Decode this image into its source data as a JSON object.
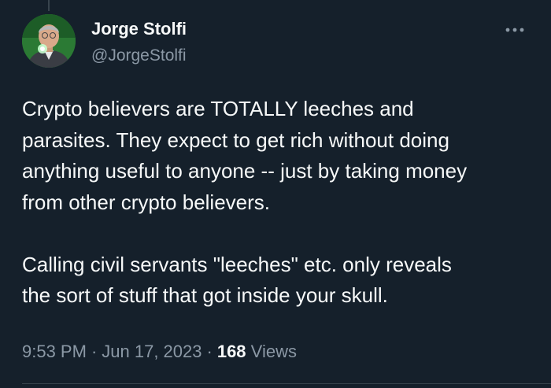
{
  "tweet": {
    "author": {
      "name": "Jorge Stolfi",
      "handle": "@JorgeStolfi"
    },
    "more_icon": "more-horizontal-icon",
    "text": "Crypto believers are TOTALLY leeches and\nparasites.  They expect to get rich without doing\nanything useful to anyone -- just by taking money\nfrom other crypto believers.\n\nCalling civil servants \"leeches\" etc. only reveals\nthe sort of stuff that got inside your skull.",
    "time": "9:53 PM",
    "separator": "·",
    "date": "Jun 17, 2023",
    "views_count": "168",
    "views_label": "Views"
  },
  "colors": {
    "background": "#15202b",
    "text_primary": "#f7f9f9",
    "text_secondary": "#8b98a5",
    "divider": "#38444d"
  }
}
